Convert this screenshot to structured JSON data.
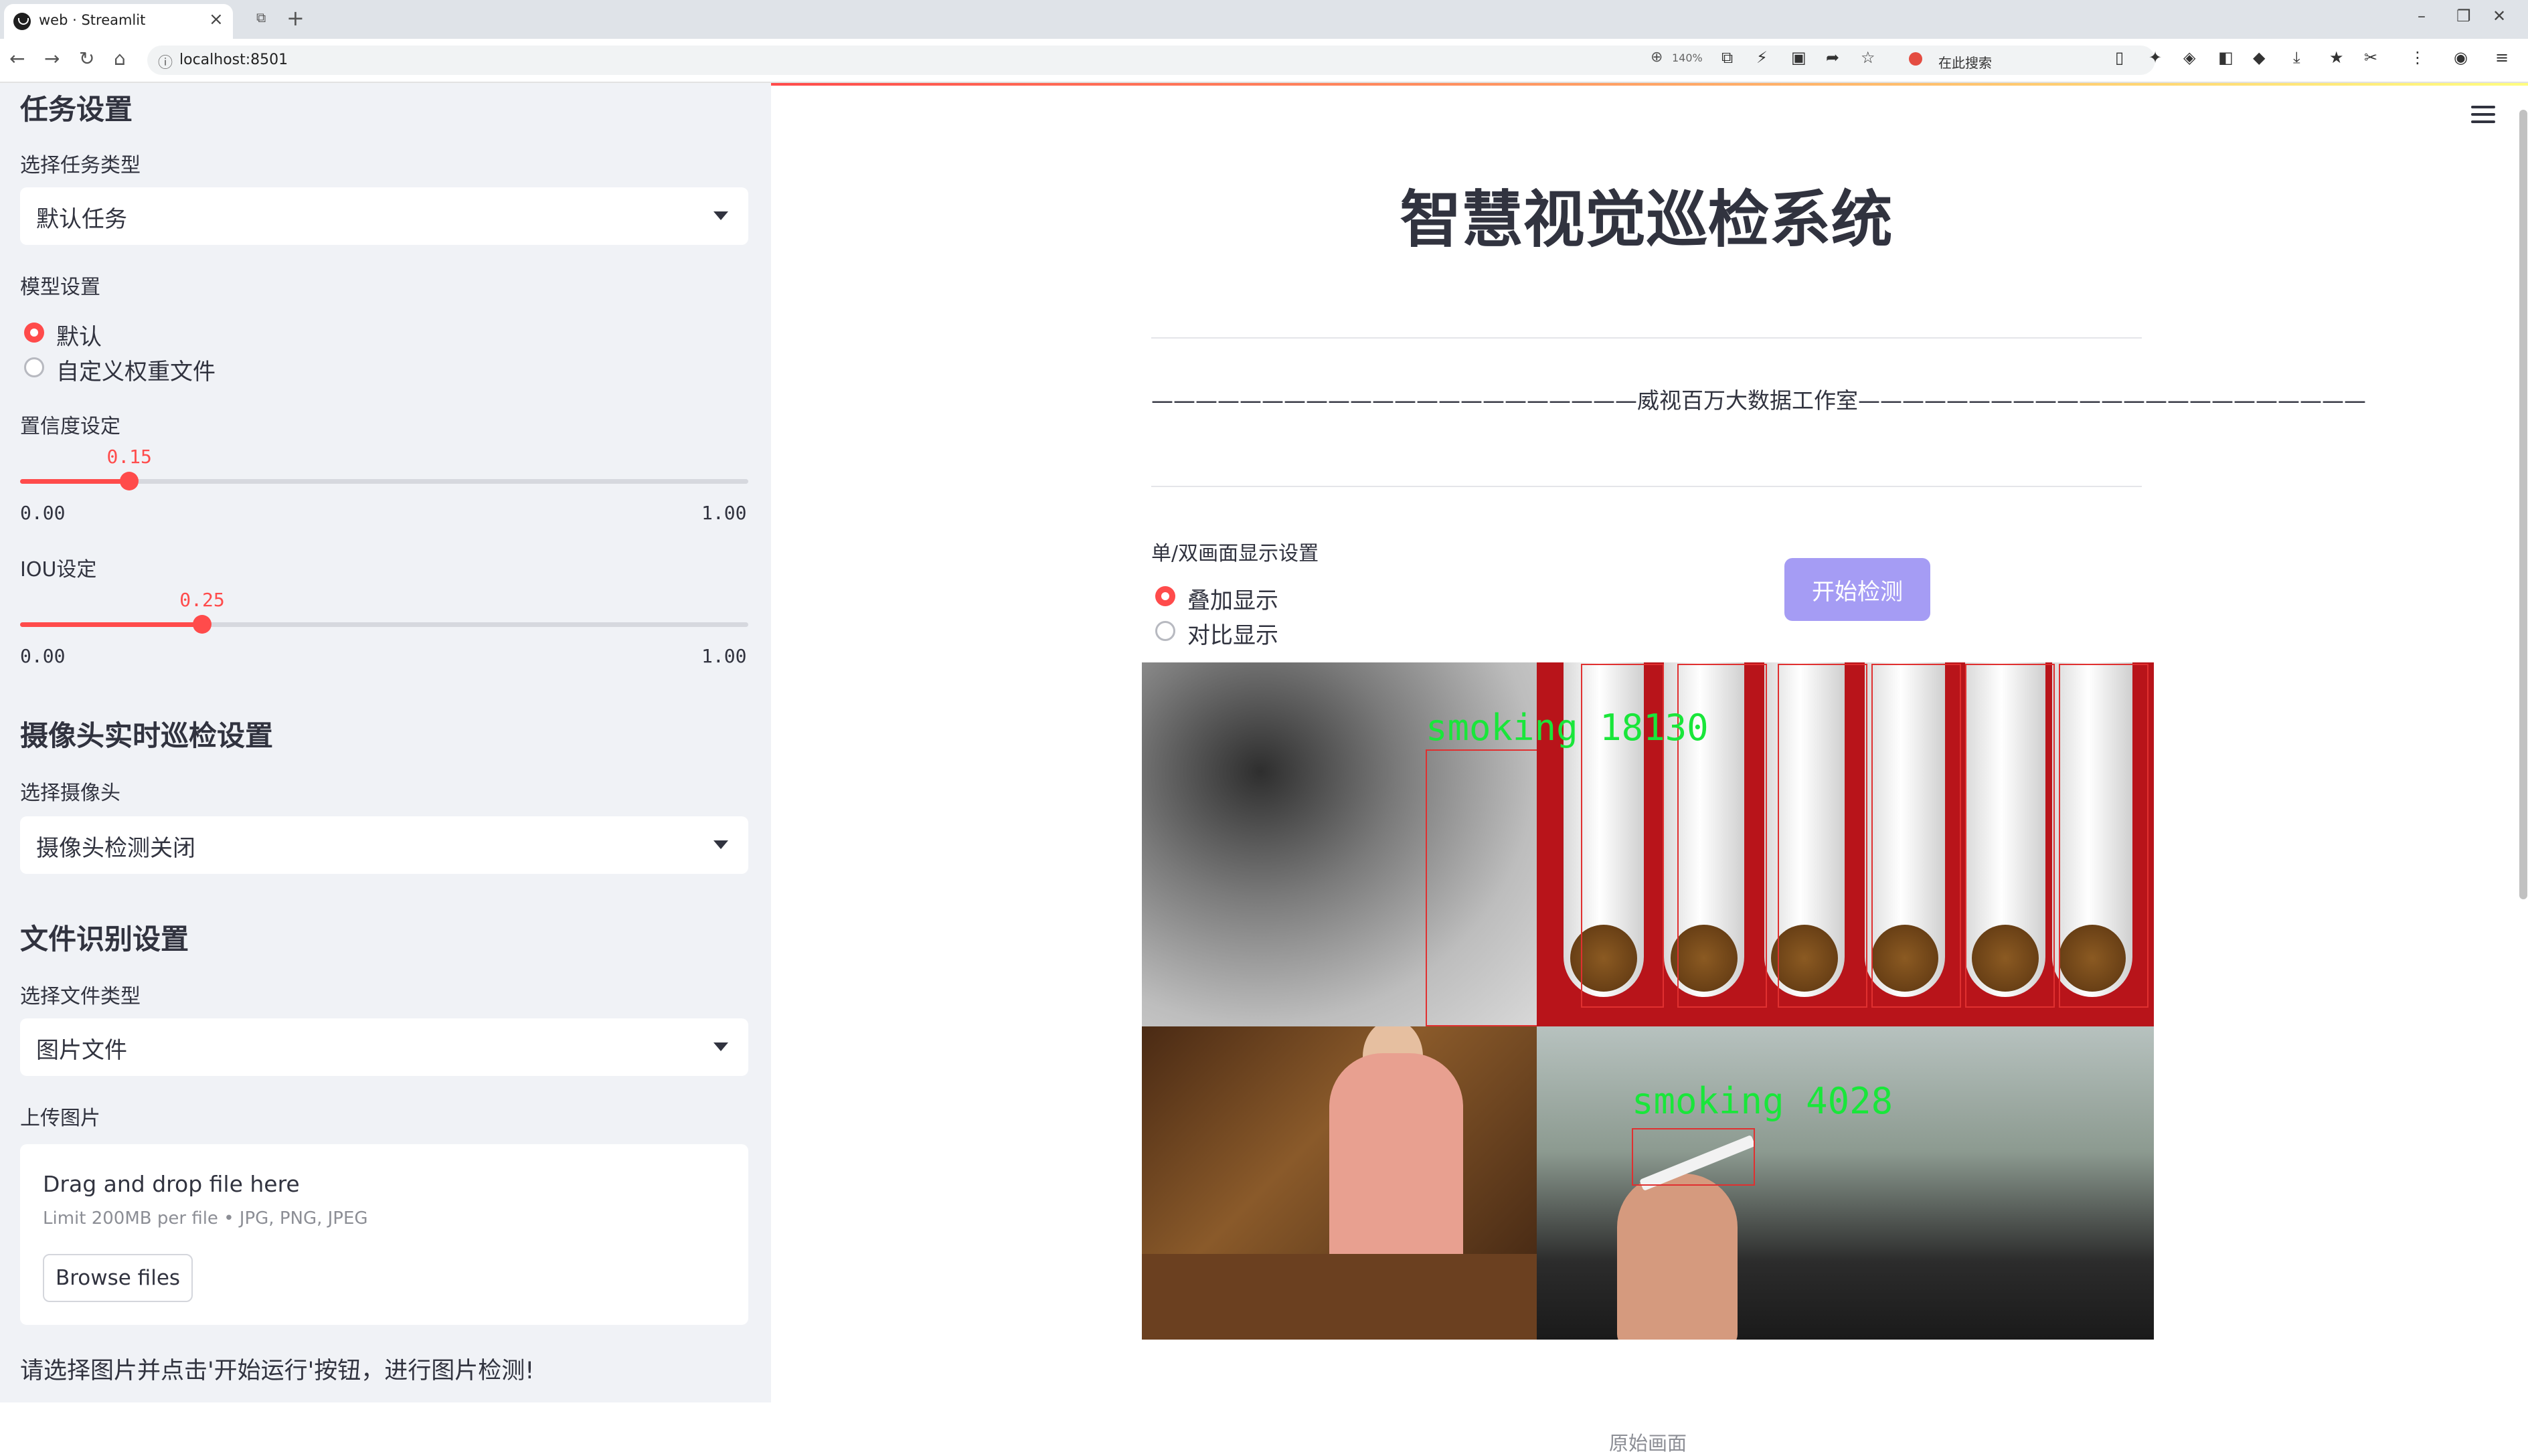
{
  "browser": {
    "tab_title": "web · Streamlit",
    "url": "localhost:8501",
    "zoom": "140%",
    "search_placeholder": "在此搜索"
  },
  "sidebar": {
    "task_section": {
      "heading": "任务设置",
      "select_label": "选择任务类型",
      "select_value": "默认任务"
    },
    "model_section": {
      "label": "模型设置",
      "options": [
        "默认",
        "自定义权重文件"
      ],
      "selected": 0
    },
    "confidence": {
      "label": "置信度设定",
      "value": 0.15,
      "value_text": "0.15",
      "min": "0.00",
      "max": "1.00"
    },
    "iou": {
      "label": "IOU设定",
      "value": 0.25,
      "value_text": "0.25",
      "min": "0.00",
      "max": "1.00"
    },
    "camera_section": {
      "heading": "摄像头实时巡检设置",
      "select_label": "选择摄像头",
      "select_value": "摄像头检测关闭"
    },
    "file_section": {
      "heading": "文件识别设置",
      "select_label": "选择文件类型",
      "select_value": "图片文件"
    },
    "upload": {
      "label": "上传图片",
      "title": "Drag and drop file here",
      "limit": "Limit 200MB per file • JPG, PNG, JPEG",
      "button": "Browse files"
    },
    "hint": "请选择图片并点击'开始运行'按钮，进行图片检测!"
  },
  "main": {
    "title": "智慧视觉巡检系统",
    "subtitle": "——————————————————————威视百万大数据工作室———————————————————————",
    "display_label": "单/双画面显示设置",
    "display_options": [
      "叠加显示",
      "对比显示"
    ],
    "display_selected": 0,
    "start_button": "开始检测",
    "detections": [
      {
        "label": "smoking",
        "id": "18130"
      },
      {
        "label": "smoking",
        "id": "4028"
      }
    ],
    "image_caption": "原始画面"
  },
  "colors": {
    "accent": "#ff4b4b",
    "sidebar_bg": "#f0f2f6",
    "button": "#a59cf4",
    "box": "#e03030",
    "label_text": "#19e63a"
  }
}
